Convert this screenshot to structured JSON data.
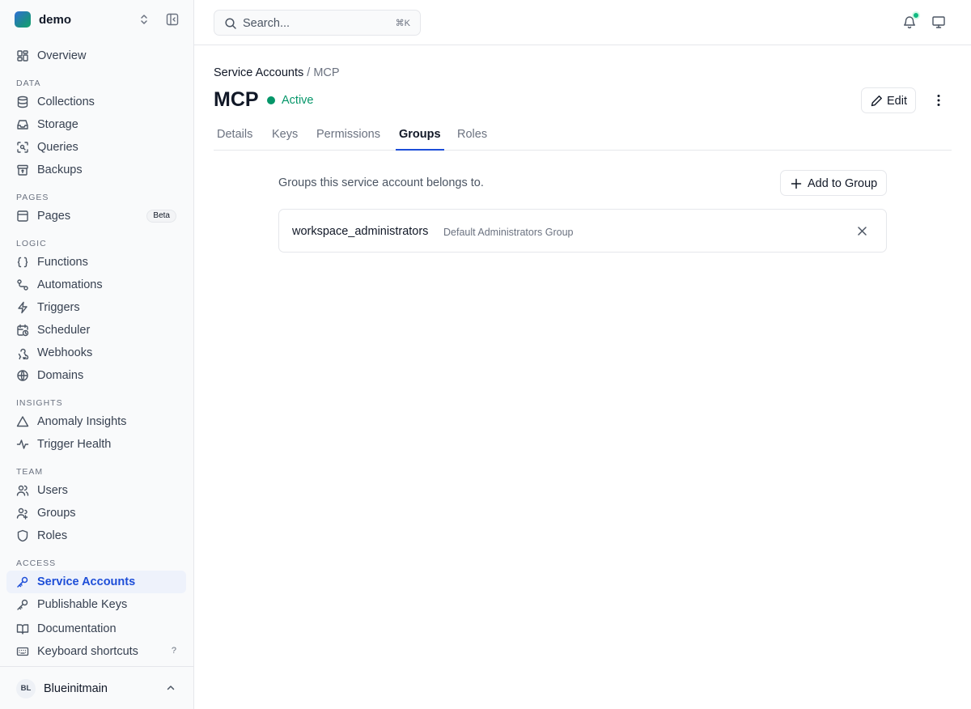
{
  "workspace": {
    "name": "demo"
  },
  "sidebar": {
    "overview": "Overview",
    "sections": {
      "data": "DATA",
      "pages": "PAGES",
      "logic": "LOGIC",
      "insights": "INSIGHTS",
      "team": "TEAM",
      "access": "ACCESS"
    },
    "items": {
      "collections": "Collections",
      "storage": "Storage",
      "queries": "Queries",
      "backups": "Backups",
      "pages": "Pages",
      "pages_badge": "Beta",
      "functions": "Functions",
      "automations": "Automations",
      "triggers": "Triggers",
      "scheduler": "Scheduler",
      "webhooks": "Webhooks",
      "domains": "Domains",
      "anomaly_insights": "Anomaly Insights",
      "trigger_health": "Trigger Health",
      "users": "Users",
      "groups": "Groups",
      "roles": "Roles",
      "service_accounts": "Service Accounts",
      "publishable_keys": "Publishable Keys",
      "documentation": "Documentation",
      "keyboard_shortcuts": "Keyboard shortcuts",
      "keyboard_shortcuts_key": "?"
    },
    "active_item": "Service Accounts"
  },
  "user": {
    "initials": "BL",
    "name": "Blueinitmain"
  },
  "topbar": {
    "search_placeholder": "Search...",
    "search_shortcut": "⌘K",
    "notification_indicator_color": "#10b981"
  },
  "page": {
    "breadcrumb": {
      "parent": "Service Accounts",
      "separator": "/",
      "current": "MCP"
    },
    "title": "MCP",
    "status": {
      "label": "Active",
      "color": "#059669"
    },
    "edit_label": "Edit",
    "tabs": [
      "Details",
      "Keys",
      "Permissions",
      "Groups",
      "Roles"
    ],
    "active_tab": "Groups",
    "groups_description": "Groups this service account belongs to.",
    "add_button_label": "Add to Group",
    "groups": [
      {
        "name": "workspace_administrators",
        "description": "Default Administrators Group"
      }
    ]
  },
  "colors": {
    "accent": "#1d4ed8",
    "active_bg": "#eef2fb",
    "success": "#059669"
  }
}
